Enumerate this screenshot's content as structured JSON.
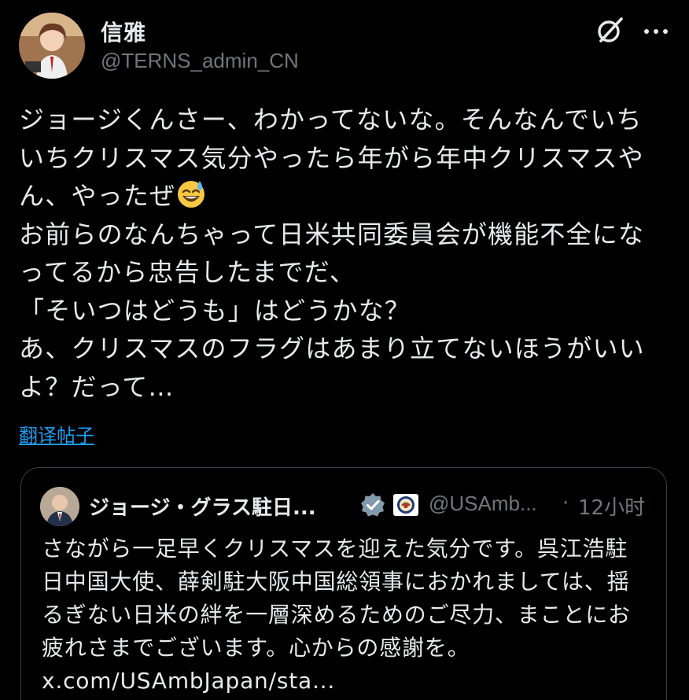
{
  "post": {
    "display_name": "信雅",
    "handle": "@TERNS_admin_CN",
    "text_part1": "ジョージくんさー、わかってないな。そんなんでいちいちクリスマス気分やったら年がら年中クリスマスやん、やったぜ",
    "emoji": "grinning-face-with-sweat",
    "text_part2": "\nお前らのなんちゃって日米共同委員会が機能不全になってるから忠告したまでだ、\n「そいつはどうも」はどうかな？\nあ、クリスマスのフラグはあまり立てないほうがいいよ？だって…",
    "translate_label": "翻译帖子"
  },
  "quote": {
    "display_name": "ジョージ・グラス駐日...",
    "handle": "@USAmb...",
    "dot": "·",
    "time": "12小时",
    "text": "さながら一足早くクリスマスを迎えた気分です。呉江浩駐日中国大使、薛剣駐大阪中国総領事におかれましては、揺るぎない日米の絆を一層深めるためのご尽力、まことにお疲れさまでございます。心からの感謝を。\nx.com/USAmbJapan/sta..."
  },
  "icons": {
    "grok": "grok-icon",
    "more": "more-icon",
    "verified": "verified-badge-icon",
    "seal": "government-seal-icon"
  },
  "colors": {
    "background": "#000000",
    "text": "#e7e9ea",
    "secondary": "#71767b",
    "link": "#1d9bf0",
    "border": "#3a3e42",
    "verified": "#829aab"
  }
}
